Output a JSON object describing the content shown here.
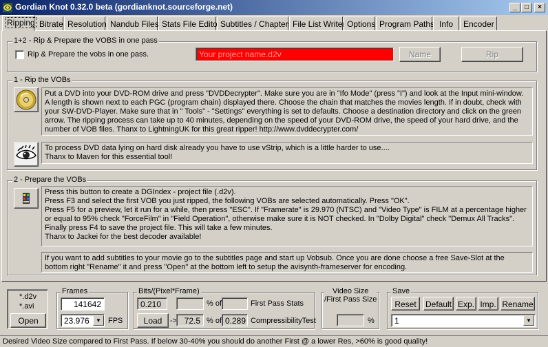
{
  "window": {
    "title": "Gordian Knot 0.32.0 beta (gordianknot.sourceforge.net)",
    "minimize": "_",
    "maximize": "□",
    "close": "×"
  },
  "tabs": [
    "Ripping",
    "Bitrate",
    "Resolution",
    "Nandub Files",
    "Stats File Editor",
    "Subtitles / Chapters",
    "File List Writer",
    "Options",
    "Program Paths",
    "Info",
    "Encoder"
  ],
  "group12": {
    "title": "1+2 - Rip & Prepare the VOBS in one pass",
    "checkbox_label": "Rip & Prepare the vobs in one pass.",
    "project_name": "Your project name.d2v",
    "name_button": "Name",
    "rip_button": "Rip"
  },
  "group1": {
    "title": "1 - Rip the VOBs",
    "text1": "Put a DVD into your DVD-ROM drive and press \"DVDDecrypter\". Make sure you are in \"Ifo Mode\" (press \"I\") and look at the Input mini-window. A length is shown next to each PGC (program chain) displayed there. Choose the chain that matches the movies length. If in doubt, check with your SW-DVD-Player. Make sure that in \" Tools\" - \"Settings\" everything is set to defaults. Choose a destination directory and click on the green arrow. The ripping process can take up to 40 minutes, depending on the speed of your DVD-ROM drive, the speed of your hard drive, and the number of VOB files.     Thanx to LightningUK for this great ripper!     http://www.dvddecrypter.com/",
    "text2": "To process DVD data lying on hard disk already you have to use vStrip, which is a little harder to use....\nThanx to Maven for this essential tool!"
  },
  "group2": {
    "title": "2 - Prepare the VOBs",
    "text1": "Press this button to create a DGIndex - project file (.d2v).\nPress F3 and select the first VOB you just ripped, the following VOBs are selected automatically. Press \"OK\".\nPress F5 for a preview, let it run for a while, then press \"ESC\". If \"Framerate\" is 29.970 (NTSC) and \"Video Type\" is FILM at a percentage higher or equal to 95% check \"ForceFilm\" in \"Field Operation\", otherwise make sure it is NOT checked. In \"Dolby Digital\" check \"Demux All Tracks\". Finally press F4 to save the project file. This will take a few minutes.\nThanx to Jackei for the best decoder available!",
    "text2": "If you want to add subtitles to your movie go to the subtitles page and start up Vobsub. Once you are done choose a free Save-Slot at the bottom right \"Rename\" it and press \"Open\" at the bottom left to setup the avisynth-frameserver for encoding."
  },
  "bottom": {
    "ext1": "*.d2v",
    "ext2": "*.avi",
    "open_button": "Open",
    "frames_title": "Frames",
    "frames_value": "141642",
    "fps_value": "23.976",
    "fps_label": "FPS",
    "bpp_title": "Bits/(Pixel*Frame)",
    "bpp_value": "0.210",
    "pct_of1": "% of",
    "first_pass_stats": "First Pass Stats",
    "load_button": "Load",
    "arrow": "->",
    "pct_value": "72.5",
    "pct_of2": "% of",
    "compress_value": "0.289",
    "compress_label": "CompressibilityTest",
    "video_size_title": "Video Size\n/First Pass Size",
    "percent": "%",
    "save_title": "Save",
    "reset_button": "Reset",
    "default_button": "Default",
    "exp_button": "Exp.",
    "imp_button": "Imp.",
    "rename_button": "Rename",
    "save_slot": "1"
  },
  "status": "Desired Video Size compared to First Pass. If below 30-40% you should do another First @ a lower Res, >60% is good quality!",
  "colors": {
    "title_start": "#0a246a",
    "title_end": "#a6caf0",
    "project_field_bg": "#ff0000",
    "project_field_text": "#ff9a9a",
    "face": "#d4d0c8"
  }
}
